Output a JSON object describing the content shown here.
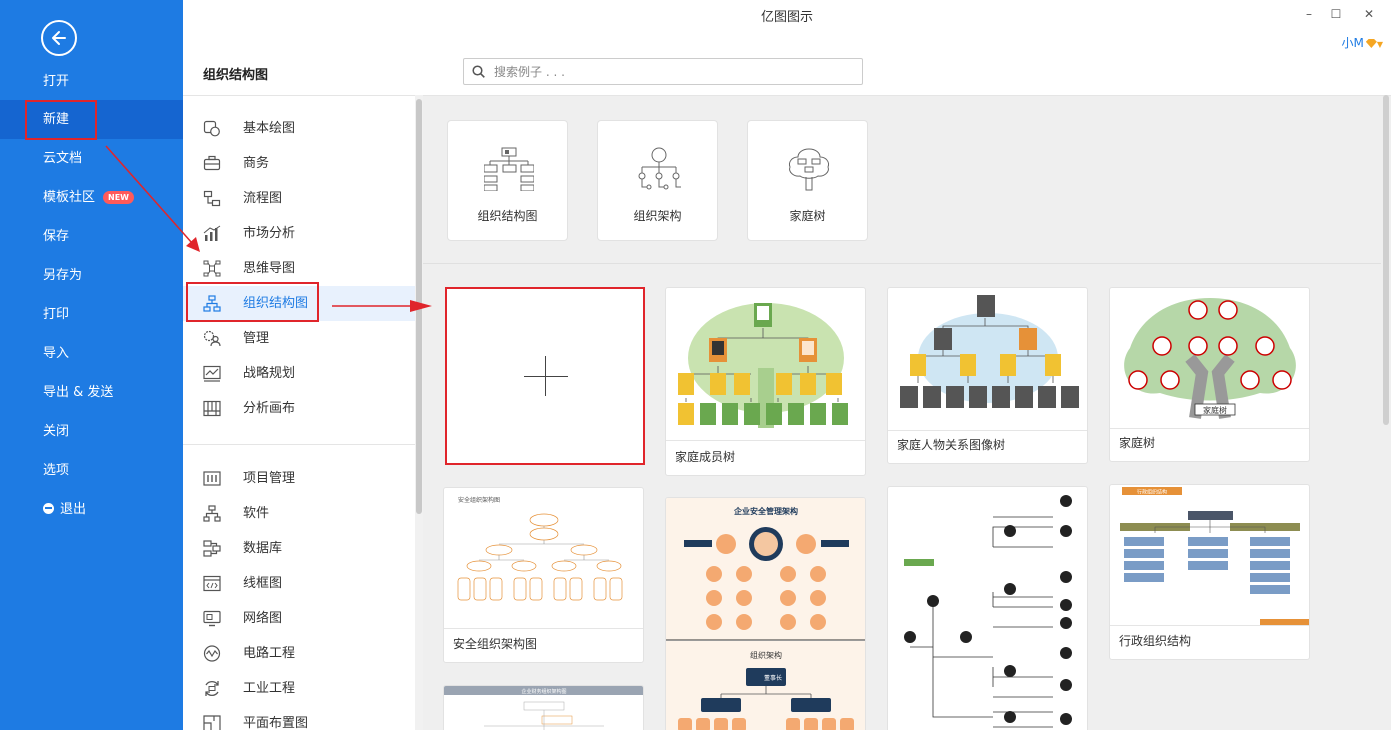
{
  "window": {
    "title": "亿图图示",
    "minimize": "–",
    "maximize": "☐",
    "close": "✕",
    "user_name": "小M"
  },
  "sidebar": {
    "items": [
      {
        "label": "打开"
      },
      {
        "label": "新建",
        "active": true
      },
      {
        "label": "云文档"
      },
      {
        "label": "模板社区",
        "badge": "NEW"
      },
      {
        "label": "保存"
      },
      {
        "label": "另存为"
      },
      {
        "label": "打印"
      },
      {
        "label": "导入"
      },
      {
        "label": "导出 & 发送"
      },
      {
        "label": "关闭"
      },
      {
        "label": "选项"
      },
      {
        "label": "退出"
      }
    ]
  },
  "header": {
    "title": "组织结构图",
    "search_placeholder": "搜索例子 . . ."
  },
  "categories": {
    "primary": [
      "基本绘图",
      "商务",
      "流程图",
      "市场分析",
      "思维导图",
      "组织结构图",
      "管理",
      "战略规划",
      "分析画布"
    ],
    "secondary": [
      "项目管理",
      "软件",
      "数据库",
      "线框图",
      "网络图",
      "电路工程",
      "工业工程",
      "平面布置图"
    ],
    "active": "组织结构图"
  },
  "subcategories": [
    "组织结构图",
    "组织架构",
    "家庭树"
  ],
  "templates": {
    "t1": "家庭成员树",
    "t2": "家庭人物关系图像树",
    "t3": "家庭树",
    "t4": "安全组织架构图",
    "t5_head": "企业安全管理架构",
    "t5_sub": "组织架构",
    "t5_node": "董事长",
    "t6": "行政组织结构",
    "t6_head": "行政组织结构",
    "t4_head": "安全组织架构图",
    "t7_head": "企业财务组织架构图",
    "t3_banner": "家庭树"
  },
  "colors": {
    "sidebar": "#1e7be3",
    "accent": "#1e7be3",
    "highlight": "#e0252b",
    "badge": "#ff5a5a"
  }
}
